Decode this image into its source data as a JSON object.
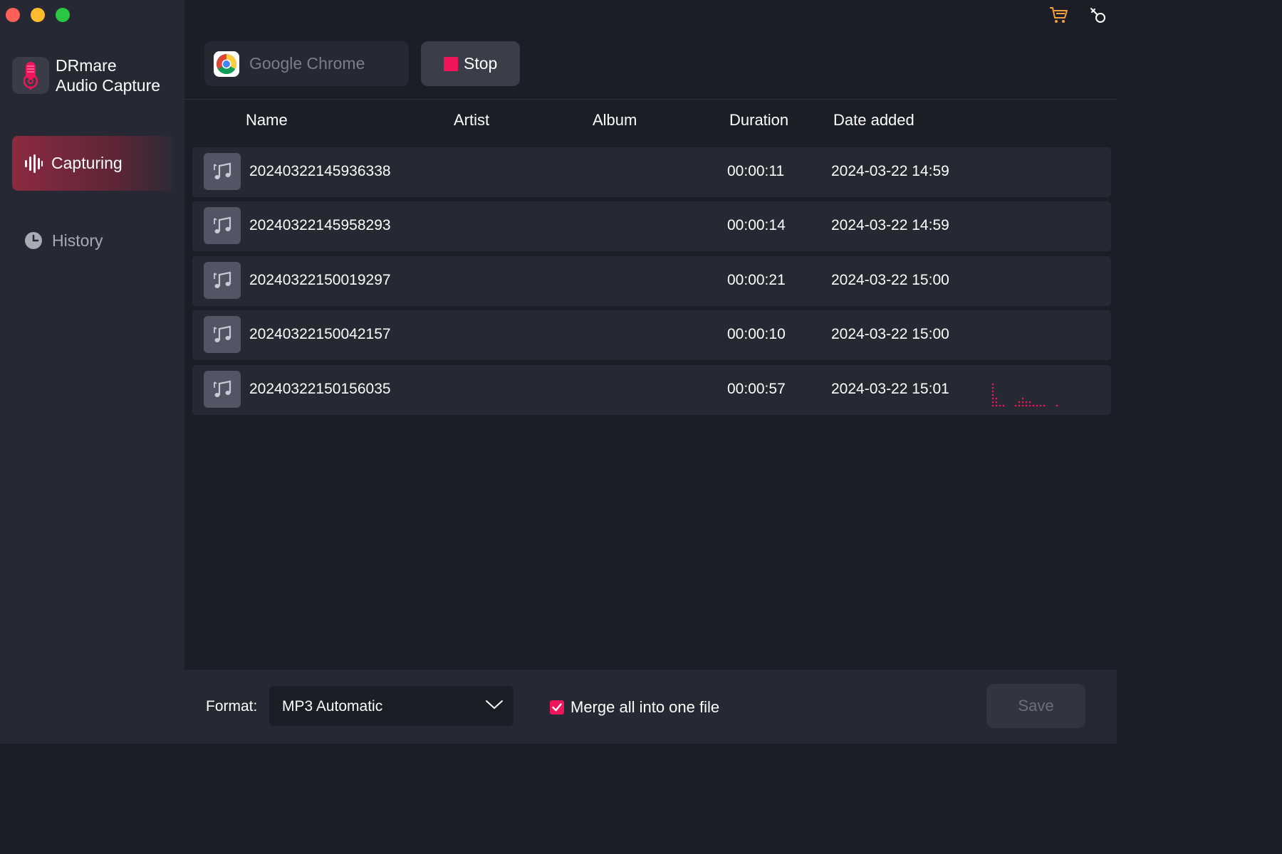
{
  "app": {
    "brand_line1": "DRmare",
    "brand_line2": "Audio Capture",
    "accent_color": "#f0145a"
  },
  "sidebar": {
    "items": [
      {
        "label": "Capturing",
        "icon": "waveform-icon",
        "active": true
      },
      {
        "label": "History",
        "icon": "clock-icon",
        "active": false
      }
    ]
  },
  "toolbar": {
    "source_label": "Google Chrome",
    "source_icon": "chrome-icon",
    "stop_label": "Stop",
    "cart_icon": "cart-icon",
    "key_icon": "key-icon"
  },
  "table": {
    "columns": [
      "Name",
      "Artist",
      "Album",
      "Duration",
      "Date added"
    ],
    "rows": [
      {
        "name": "20240322145936338",
        "artist": "",
        "album": "",
        "duration": "00:00:11",
        "date": "2024-03-22 14:59"
      },
      {
        "name": "20240322145958293",
        "artist": "",
        "album": "",
        "duration": "00:00:14",
        "date": "2024-03-22 14:59"
      },
      {
        "name": "20240322150019297",
        "artist": "",
        "album": "",
        "duration": "00:00:21",
        "date": "2024-03-22 15:00"
      },
      {
        "name": "20240322150042157",
        "artist": "",
        "album": "",
        "duration": "00:00:10",
        "date": "2024-03-22 15:00"
      },
      {
        "name": "20240322150156035",
        "artist": "",
        "album": "",
        "duration": "00:00:57",
        "date": "2024-03-22 15:01",
        "recording": true
      }
    ]
  },
  "footer": {
    "format_label": "Format:",
    "format_value": "MP3 Automatic",
    "merge_label": "Merge all into one file",
    "merge_checked": true,
    "save_label": "Save"
  }
}
